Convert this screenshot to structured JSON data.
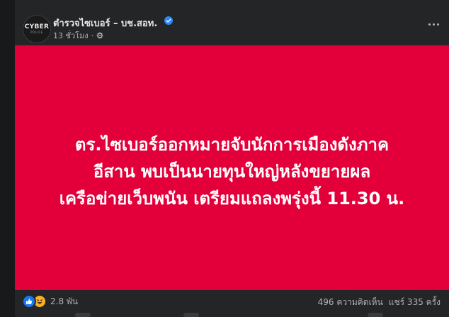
{
  "post": {
    "page_name": "ตำรวจไซเบอร์ – บช.สอท.",
    "verified": true,
    "timestamp": "13 ชั่วโมง",
    "separator": "·",
    "privacy_icon": "gear-globe-icon",
    "avatar_logo_main": "CYBER",
    "avatar_logo_sub": "POLICE",
    "image": {
      "background_color": "#e3003a",
      "headline_lines": [
        "ตร.ไซเบอร์ออกหมายจับนักการเมืองดังภาค",
        "อีสาน พบเป็นนายทุนใหญ่หลังขยายผล",
        "เครือข่ายเว็บพนัน เตรียมแถลงพรุ่งนี้ 11.30 น."
      ]
    }
  },
  "engagement": {
    "reaction_icons": [
      "like-icon",
      "haha-icon"
    ],
    "reaction_count": "2.8 พัน",
    "comments": "496 ความคิดเห็น",
    "shares": "แชร์ 335 ครั้ง"
  },
  "colors": {
    "background": "#18191a",
    "card": "#242526",
    "text_primary": "#e4e6eb",
    "text_secondary": "#b0b3b8",
    "verified_blue": "#2d88ff",
    "like_blue": "#1877f2",
    "haha_yellow": "#f7b125"
  }
}
